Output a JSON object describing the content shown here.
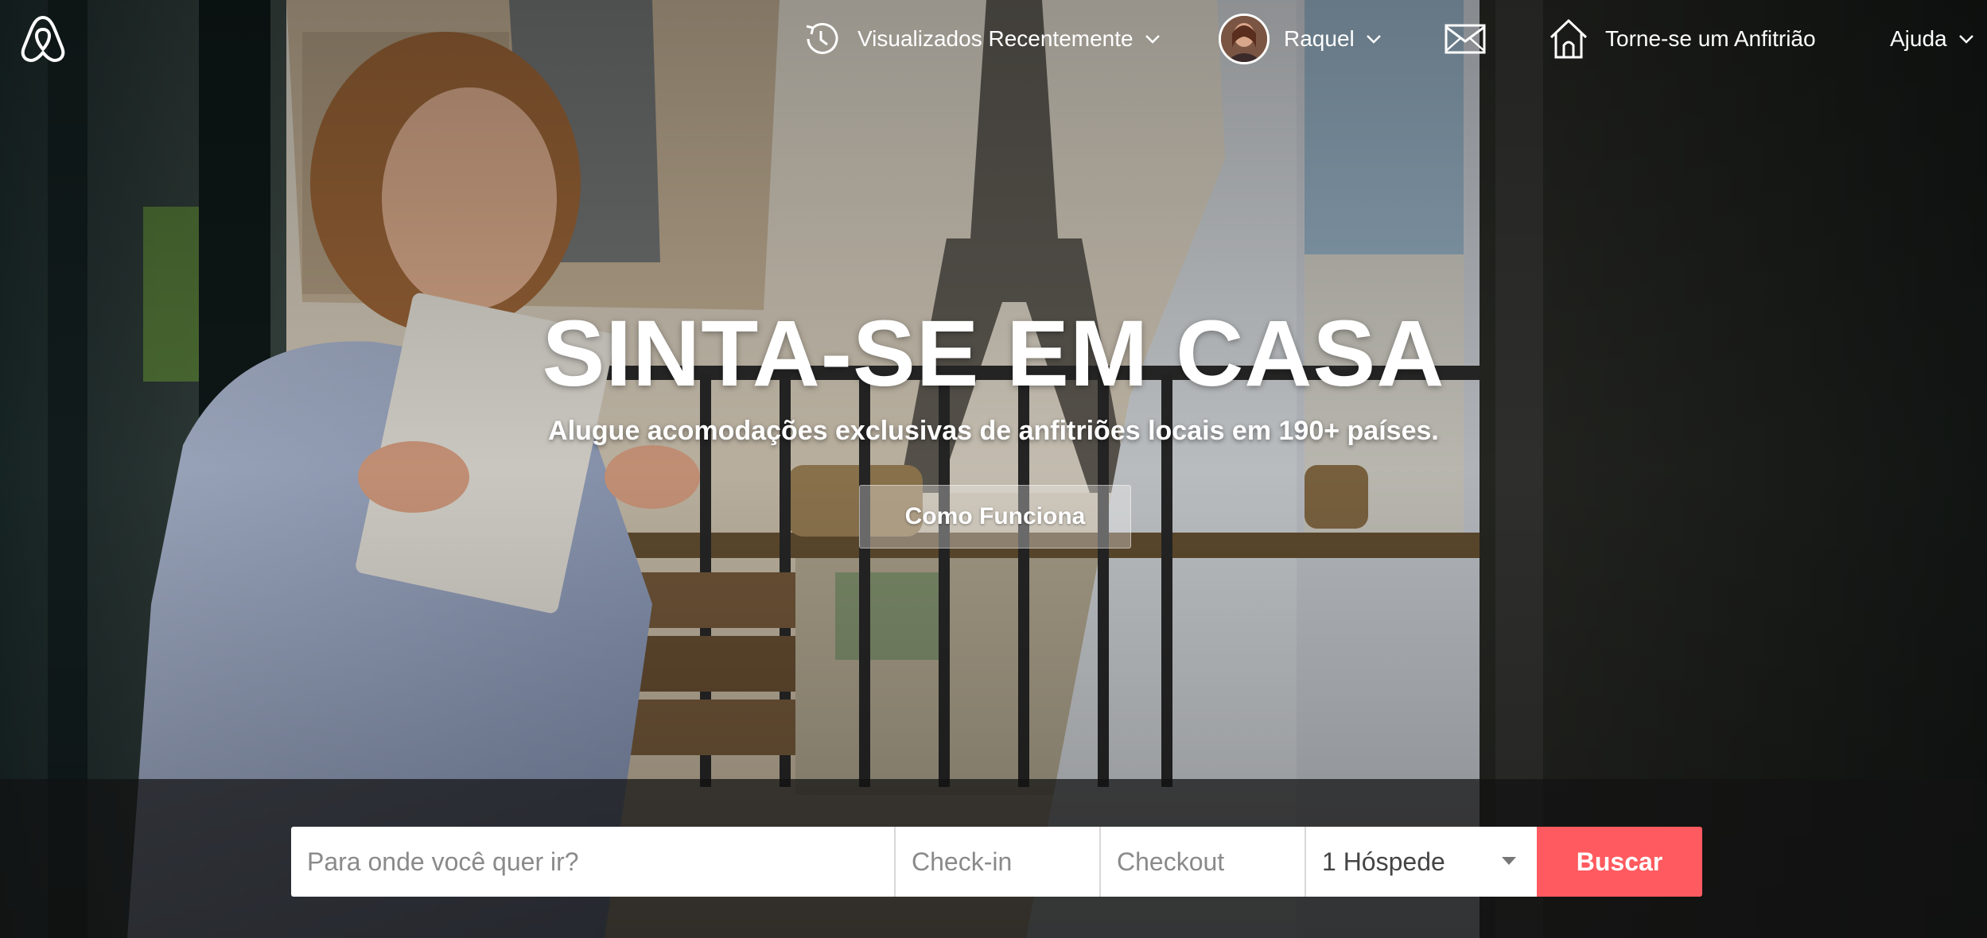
{
  "brand": {
    "logo_icon": "airbnb-belo-icon"
  },
  "nav": {
    "recent_label": "Visualizados Recentemente",
    "user_name": "Raquel",
    "host_label": "Torne-se um Anfitrião",
    "help_label": "Ajuda",
    "icons": [
      "history-clock-icon",
      "chevron-down-icon",
      "avatar",
      "envelope-icon",
      "house-icon"
    ]
  },
  "hero": {
    "title": "SINTA-SE EM CASA",
    "subtitle": "Alugue acomodações exclusivas de anfitriões locais em 190+ países.",
    "cta_label": "Como Funciona"
  },
  "search": {
    "where_placeholder": "Para onde você quer ir?",
    "checkin_placeholder": "Check-in",
    "checkout_placeholder": "Checkout",
    "guests_value": "1 Hóspede",
    "submit_label": "Buscar"
  },
  "colors": {
    "accent": "#ff5a5f",
    "overlay": "#121212"
  }
}
